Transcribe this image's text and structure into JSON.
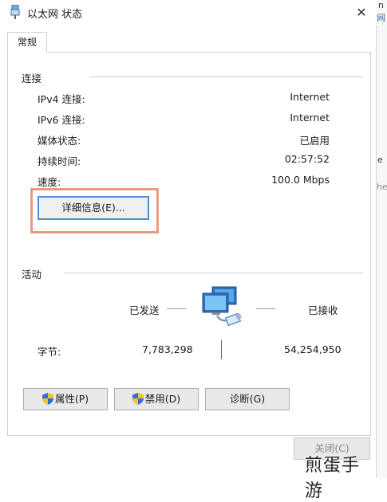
{
  "window": {
    "title": "以太网 状态",
    "close_glyph": "✕"
  },
  "tabs": [
    {
      "label": "常规",
      "active": true
    }
  ],
  "connection": {
    "title": "连接",
    "rows": [
      {
        "label": "IPv4 连接:",
        "value": "Internet"
      },
      {
        "label": "IPv6 连接:",
        "value": "Internet"
      },
      {
        "label": "媒体状态:",
        "value": "已启用"
      },
      {
        "label": "持续时间:",
        "value": "02:57:52"
      },
      {
        "label": "速度:",
        "value": "100.0 Mbps"
      }
    ],
    "details_button": "详细信息(E)..."
  },
  "activity": {
    "title": "活动",
    "sent_label": "已发送",
    "received_label": "已接收",
    "bytes_label": "字节:",
    "bytes_sent": "7,783,298",
    "bytes_received": "54,254,950"
  },
  "buttons": {
    "properties": "属性(P)",
    "disable": "禁用(D)",
    "diagnose": "诊断(G)",
    "close": "关闭(C)"
  },
  "background_fragments": {
    "top": "n",
    "link": "网",
    "mid": "e",
    "right": "he"
  },
  "watermark": "煎蛋手游",
  "colors": {
    "highlight": "#e89a82",
    "focus_border": "#4f8ed6",
    "shield_blue": "#2f6fd1",
    "shield_yellow": "#f2c230"
  },
  "icons": {
    "title": "ethernet-plug-icon",
    "network": "network-computer-icon",
    "shield": "uac-shield-icon"
  }
}
